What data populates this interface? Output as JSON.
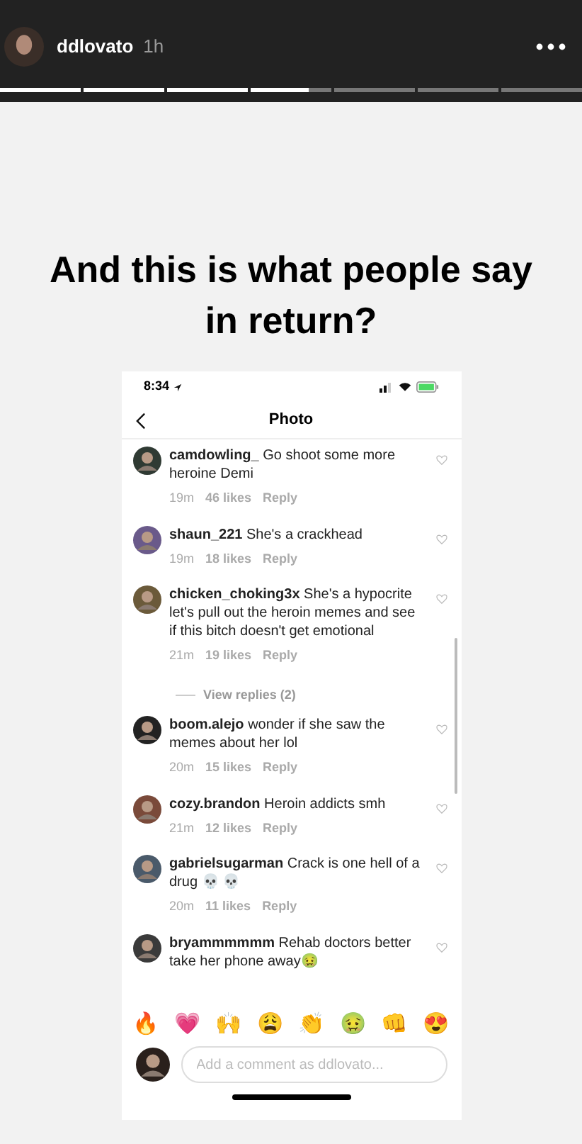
{
  "story": {
    "username": "ddlovato",
    "time": "1h",
    "progress": {
      "level": 0.53
    }
  },
  "headline": "And this is what people say in return?",
  "screenshot": {
    "status_time": "8:34",
    "nav_title": "Photo",
    "comments": [
      {
        "kind": "comment",
        "username": "camdowling_",
        "text": "Go shoot some more heroine Demi",
        "time": "19m",
        "likes": "46 likes",
        "reply": "Reply"
      },
      {
        "kind": "comment",
        "username": "shaun_221",
        "text": "She's a crackhead",
        "time": "19m",
        "likes": "18 likes",
        "reply": "Reply"
      },
      {
        "kind": "comment",
        "username": "chicken_choking3x",
        "text": "She's a hypocrite let's pull out the heroin memes and see if this bitch doesn't get emotional",
        "time": "21m",
        "likes": "19 likes",
        "reply": "Reply"
      },
      {
        "kind": "replies",
        "text": "View replies (2)"
      },
      {
        "kind": "comment",
        "username": "boom.alejo",
        "text": "wonder if she saw the memes about her lol",
        "time": "20m",
        "likes": "15 likes",
        "reply": "Reply"
      },
      {
        "kind": "comment",
        "username": "cozy.brandon",
        "text": "Heroin addicts smh",
        "time": "21m",
        "likes": "12 likes",
        "reply": "Reply"
      },
      {
        "kind": "comment",
        "username": "gabrielsugarman",
        "text": "Crack is one hell of a drug 💀 💀",
        "time": "20m",
        "likes": "11 likes",
        "reply": "Reply"
      },
      {
        "kind": "comment",
        "username": "bryammmmmm",
        "text": "Rehab doctors better take her phone away🤢"
      }
    ],
    "reactions": [
      "🔥",
      "💗",
      "🙌",
      "😩",
      "👏",
      "🤢",
      "👊",
      "😍"
    ],
    "comment_placeholder": "Add a comment as ddlovato..."
  }
}
